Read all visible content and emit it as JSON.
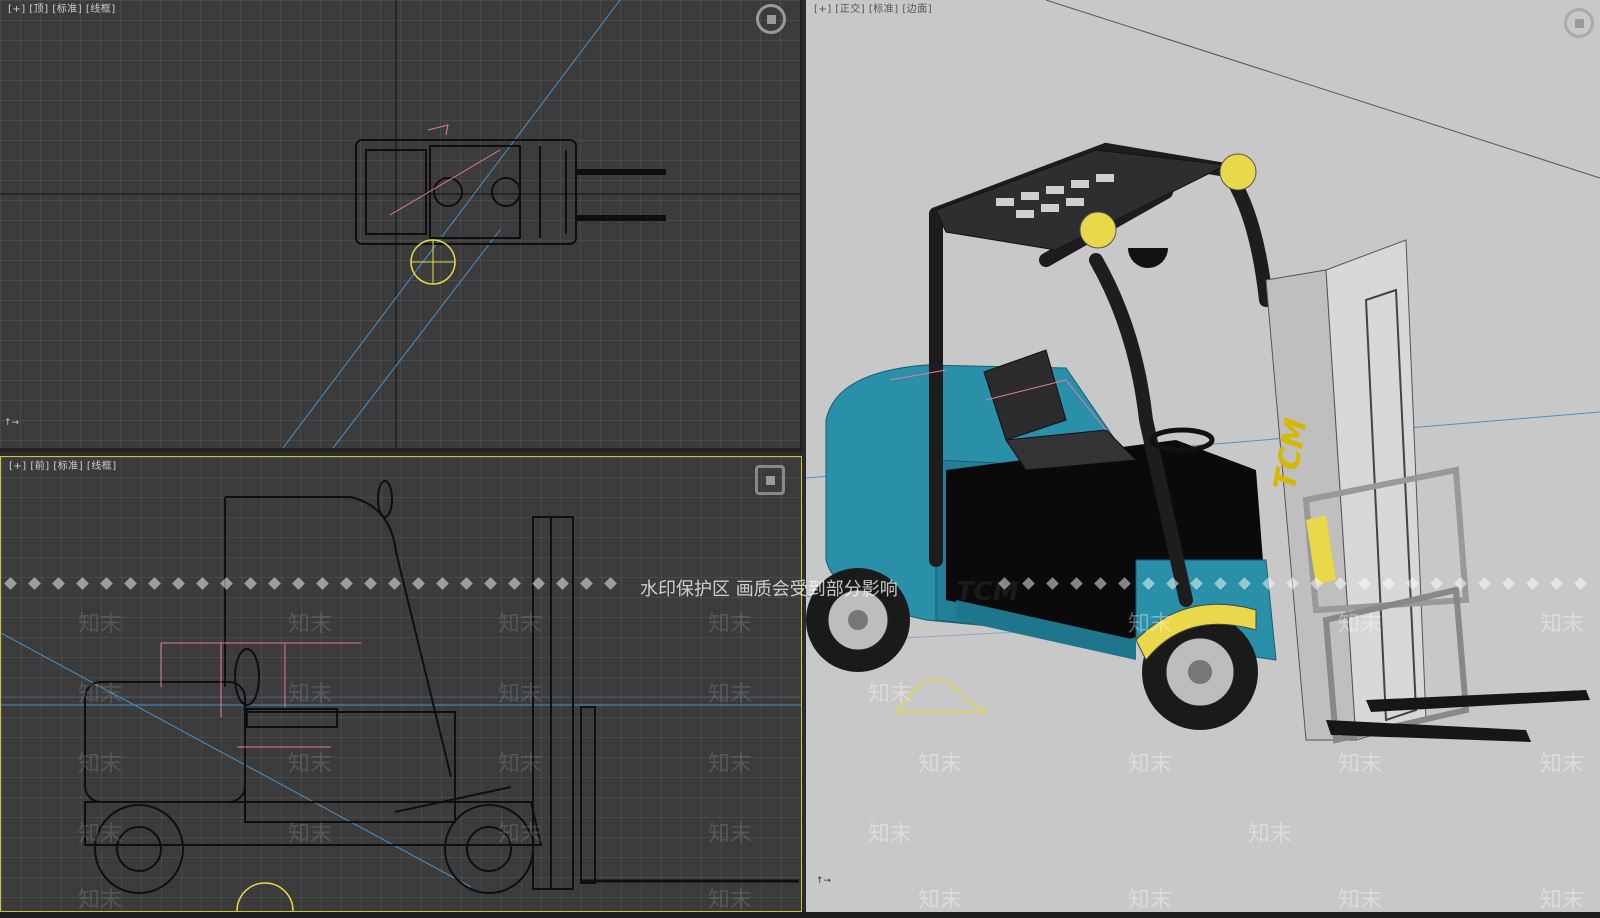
{
  "viewports": {
    "top": {
      "label": "[+] [顶] [标准] [线框]"
    },
    "front": {
      "label": "[+] [前] [标准] [线框]"
    },
    "perspective": {
      "label": "[+] [正交] [标准] [边面]"
    }
  },
  "model": {
    "brand_text": "TCM"
  },
  "watermark": {
    "text": "水印保护区  画质会受到部分影响",
    "tile_text": "知末"
  },
  "colors": {
    "viewport_dark": "#3b3b3b",
    "viewport_light": "#c8c8c8",
    "body_teal": "#2a8fa8",
    "selection_yellow": "#e8d84a"
  }
}
